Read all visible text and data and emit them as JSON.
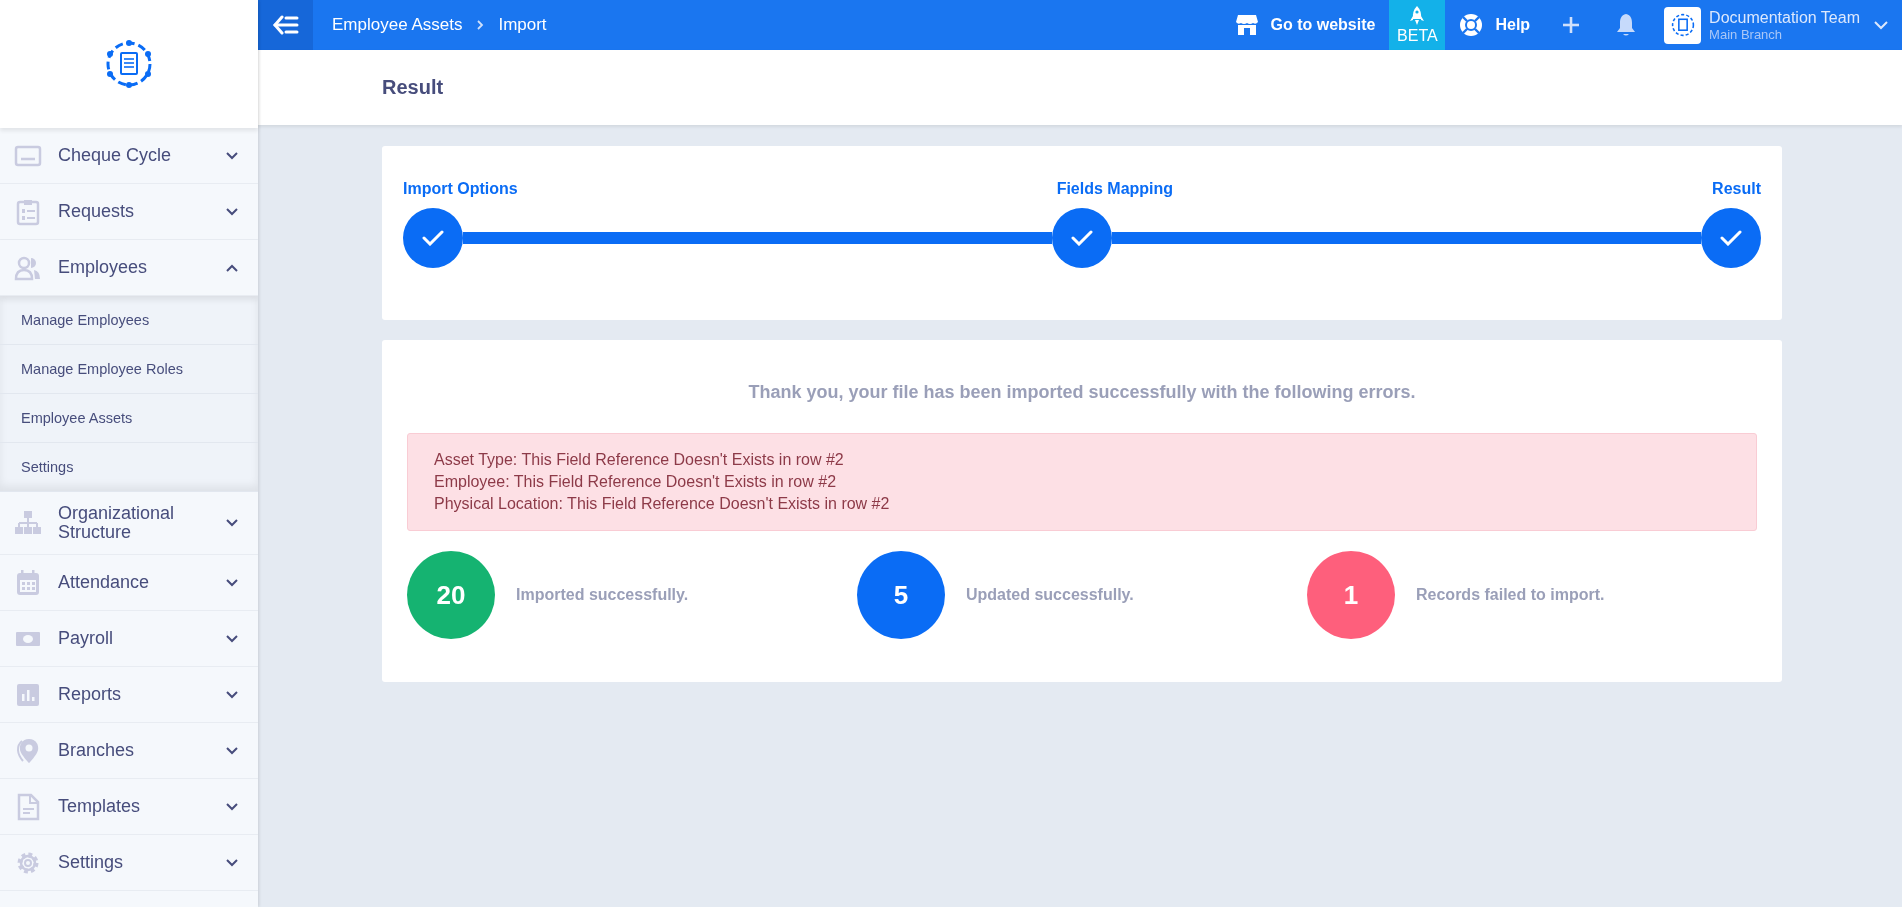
{
  "sidebar": {
    "items": [
      {
        "label": "Cheque Cycle",
        "expanded": false
      },
      {
        "label": "Requests",
        "expanded": false
      },
      {
        "label": "Employees",
        "expanded": true,
        "children": [
          {
            "label": "Manage Employees"
          },
          {
            "label": "Manage Employee Roles"
          },
          {
            "label": "Employee Assets"
          },
          {
            "label": "Settings"
          }
        ]
      },
      {
        "label": "Organizational Structure",
        "expanded": false
      },
      {
        "label": "Attendance",
        "expanded": false
      },
      {
        "label": "Payroll",
        "expanded": false
      },
      {
        "label": "Reports",
        "expanded": false
      },
      {
        "label": "Branches",
        "expanded": false
      },
      {
        "label": "Templates",
        "expanded": false
      },
      {
        "label": "Settings",
        "expanded": false
      }
    ]
  },
  "topbar": {
    "breadcrumb": [
      "Employee Assets",
      "Import"
    ],
    "website": "Go to website",
    "beta": "BETA",
    "help": "Help",
    "account": {
      "name": "Documentation Team",
      "branch": "Main Branch"
    }
  },
  "page_title": "Result",
  "steps": [
    {
      "label": "Import Options",
      "done": true
    },
    {
      "label": "Fields Mapping",
      "done": true
    },
    {
      "label": "Result",
      "done": true
    }
  ],
  "result": {
    "message": "Thank you, your file has been imported successfully with the following errors.",
    "errors": [
      "Asset Type: This Field Reference Doesn't Exists in row #2",
      "Employee: This Field Reference Doesn't Exists in row #2",
      "Physical Location: This Field Reference Doesn't Exists in row #2"
    ],
    "stats": [
      {
        "count": "20",
        "label": "Imported successfully.",
        "color": "#15b371"
      },
      {
        "count": "5",
        "label": "Updated successfully.",
        "color": "#0a6cf5"
      },
      {
        "count": "1",
        "label": "Records failed to import.",
        "color": "#fe5f7c"
      }
    ]
  }
}
